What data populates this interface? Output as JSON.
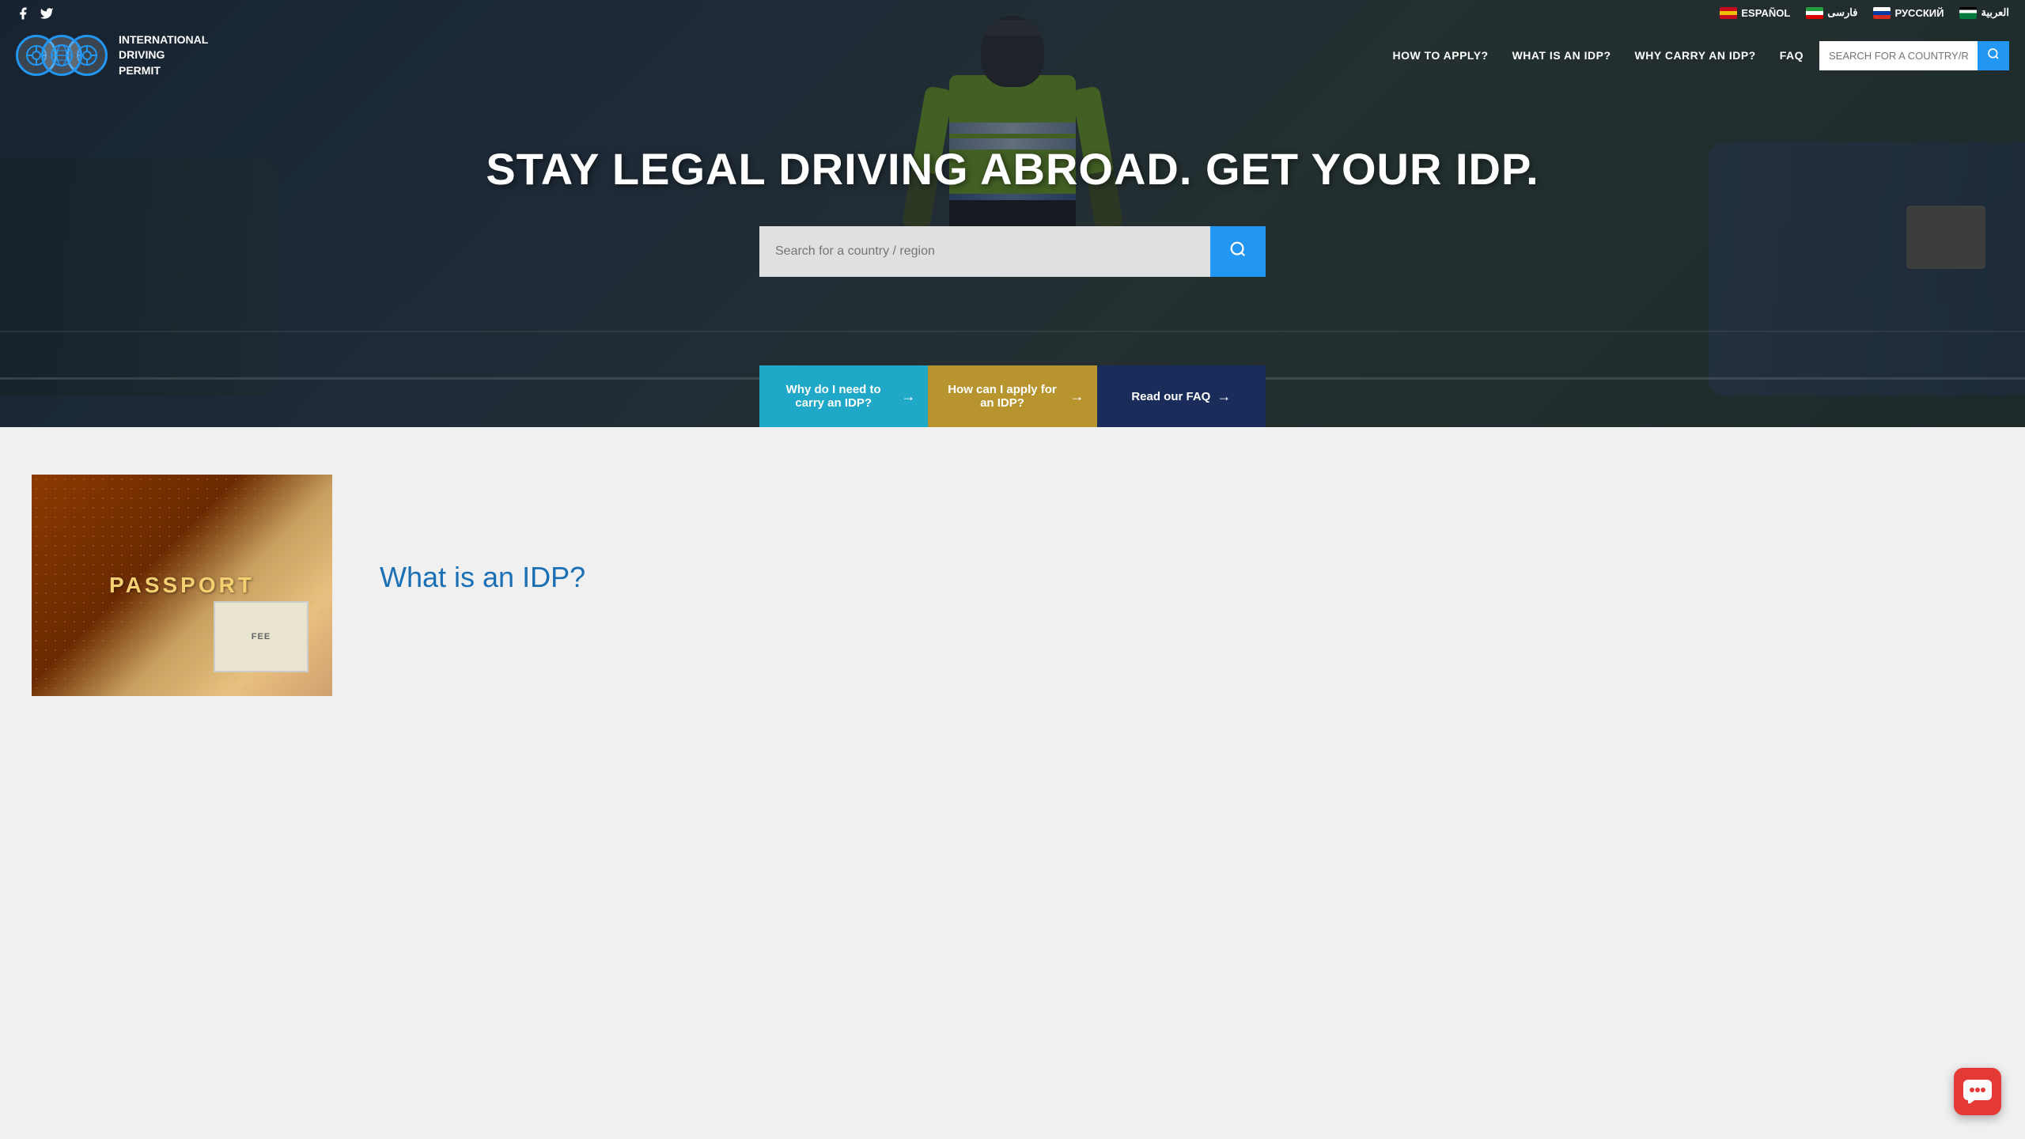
{
  "social": {
    "facebook_label": "f",
    "twitter_label": "t"
  },
  "languages": [
    {
      "id": "es",
      "label": "ESPAÑOL",
      "flag_class": "flag-es"
    },
    {
      "id": "fa",
      "label": "فارسی",
      "flag_class": "flag-ir"
    },
    {
      "id": "ru",
      "label": "РУССКИЙ",
      "flag_class": "flag-ru"
    },
    {
      "id": "ar",
      "label": "العربية",
      "flag_class": "flag-ar"
    }
  ],
  "logo": {
    "line1": "INTERNATIONAL",
    "line2": "DRIVING",
    "line3": "PERMIT"
  },
  "nav": {
    "items": [
      {
        "id": "how-to-apply",
        "label": "HOW TO APPLY?"
      },
      {
        "id": "what-is-idp",
        "label": "WHAT IS AN IDP?"
      },
      {
        "id": "why-carry",
        "label": "WHY CARRY AN IDP?"
      },
      {
        "id": "faq",
        "label": "FAQ"
      }
    ],
    "search_placeholder": "SEARCH FOR A COUNTRY/REGION"
  },
  "hero": {
    "title": "STAY LEGAL DRIVING ABROAD. GET YOUR IDP.",
    "search_placeholder": "Search for a country / region",
    "cta_buttons": [
      {
        "id": "why-carry",
        "label": "Why do I need to carry an IDP?",
        "style": "blue"
      },
      {
        "id": "how-apply",
        "label": "How can I apply for an IDP?",
        "style": "gold"
      },
      {
        "id": "read-faq",
        "label": "Read our FAQ",
        "style": "navy"
      }
    ]
  },
  "passport_section": {
    "passport_label": "PASSPORT",
    "card_label": "FEE",
    "what_is_title": "What is an IDP?"
  },
  "colors": {
    "primary_blue": "#1fa8c7",
    "nav_blue": "#2196f3",
    "accent_gold": "#b8942e",
    "accent_navy": "#1a2d5a",
    "logo_blue": "#2196f3",
    "heading_blue": "#1a6fb5",
    "red": "#e53935"
  }
}
